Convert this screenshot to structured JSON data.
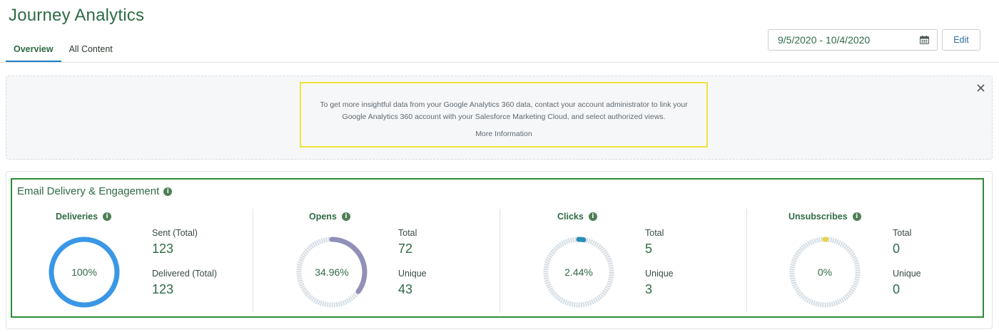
{
  "app": {
    "title": "Journey Analytics"
  },
  "tabs": [
    {
      "label": "Overview",
      "active": true
    },
    {
      "label": "All Content",
      "active": false
    }
  ],
  "date_range": {
    "value": "9/5/2020 - 10/4/2020",
    "icon": "calendar-icon"
  },
  "edit_label": "Edit",
  "banner": {
    "line1": "To get more insightful data from your Google Analytics 360 data, contact your account administrator to link your",
    "line2": "Google Analytics 360 account with your Salesforce Marketing Cloud, and select authorized views.",
    "link": "More Information",
    "close_icon": "close-icon"
  },
  "section": {
    "title": "Email Delivery & Engagement",
    "info_icon": "info-icon"
  },
  "metrics": [
    {
      "title": "Deliveries",
      "ring_value": "100%",
      "ring_fraction": 1.0,
      "ring_color": "#3a97e6",
      "stats": [
        {
          "label": "Sent (Total)",
          "value": "123"
        },
        {
          "label": "Delivered (Total)",
          "value": "123"
        }
      ]
    },
    {
      "title": "Opens",
      "ring_value": "34.96%",
      "ring_fraction": 0.3496,
      "ring_color": "#9190b8",
      "stats": [
        {
          "label": "Total",
          "value": "72"
        },
        {
          "label": "Unique",
          "value": "43"
        }
      ]
    },
    {
      "title": "Clicks",
      "ring_value": "2.44%",
      "ring_fraction": 0.0244,
      "ring_color": "#2a8fb5",
      "stats": [
        {
          "label": "Total",
          "value": "5"
        },
        {
          "label": "Unique",
          "value": "3"
        }
      ]
    },
    {
      "title": "Unsubscribes",
      "ring_value": "0%",
      "ring_fraction": 0.0,
      "ring_color": "#e8d44a",
      "stats": [
        {
          "label": "Total",
          "value": "0"
        },
        {
          "label": "Unique",
          "value": "0"
        }
      ]
    }
  ],
  "colors": {
    "ring_track": "#d4dde4",
    "accent": "#1e7fc6",
    "title_green": "#2e6b46",
    "banner_border": "#f0e33a",
    "card_border": "#2f8a3a"
  }
}
